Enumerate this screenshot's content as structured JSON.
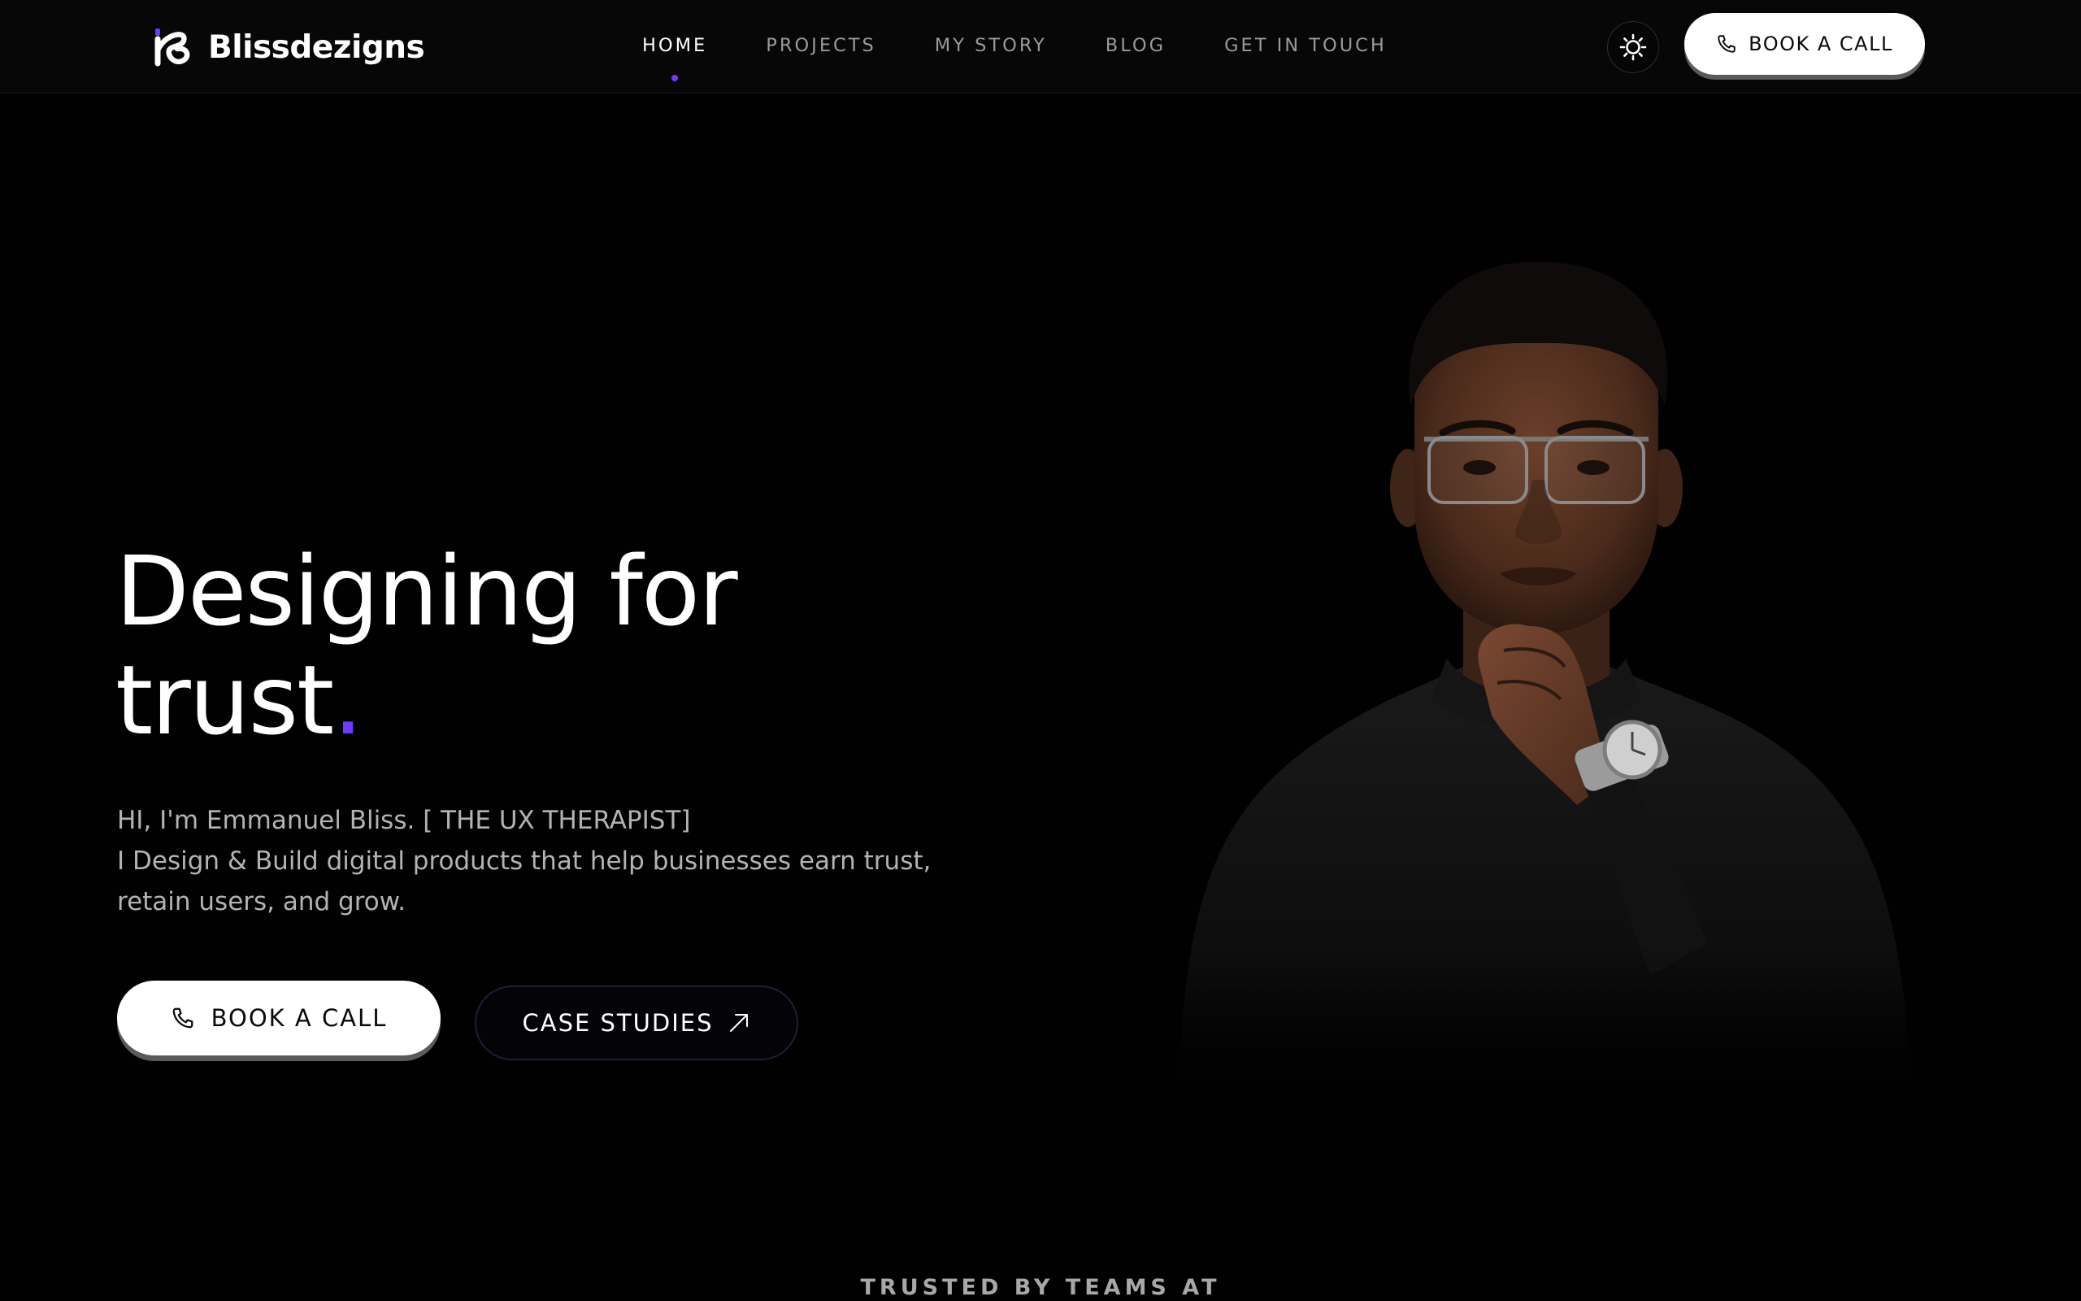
{
  "brand": {
    "name": "Blissdezigns",
    "accent_color": "#6c3bff"
  },
  "nav": {
    "items": [
      {
        "label": "HOME",
        "active": true
      },
      {
        "label": "PROJECTS",
        "active": false
      },
      {
        "label": "MY STORY",
        "active": false
      },
      {
        "label": "BLOG",
        "active": false
      },
      {
        "label": "GET IN TOUCH",
        "active": false
      }
    ]
  },
  "header": {
    "theme_toggle_icon": "sun-moon-icon",
    "cta_label": "BOOK A CALL",
    "cta_icon": "phone-icon"
  },
  "hero": {
    "title_line1": "Designing for",
    "title_line2": "trust",
    "title_accent": ".",
    "intro_line1": "HI, I'm Emmanuel Bliss. [ THE UX THERAPIST]",
    "intro_line2": "I Design & Build digital products that help businesses earn trust,",
    "intro_line3": "retain users, and grow.",
    "primary_cta": "BOOK A CALL",
    "secondary_cta": "CASE STUDIES",
    "secondary_cta_icon": "arrow-up-right-icon"
  },
  "trusted": {
    "label": "TRUSTED BY TEAMS AT"
  }
}
